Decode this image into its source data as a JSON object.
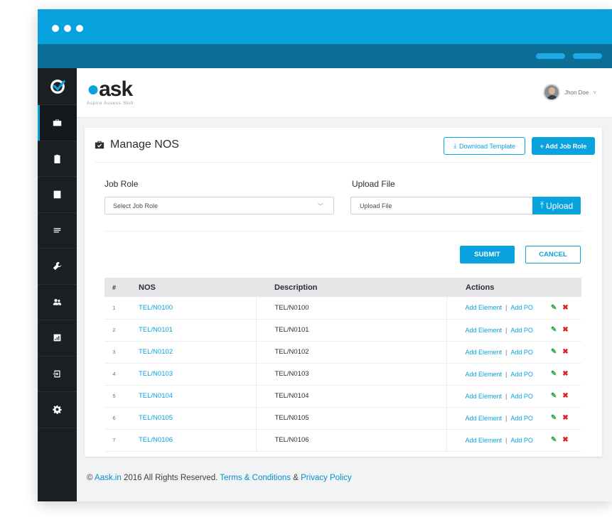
{
  "brand": {
    "name": "ask",
    "tagline": "Aspire Assess Skill"
  },
  "user": {
    "name": "Jhon Doe",
    "chevron": "˅"
  },
  "sidebar": {
    "items": [
      {
        "icon": "briefcase-icon"
      },
      {
        "icon": "clipboard-icon"
      },
      {
        "icon": "id-badge-icon"
      },
      {
        "icon": "list-icon"
      },
      {
        "icon": "wrench-icon"
      },
      {
        "icon": "users-icon"
      },
      {
        "icon": "bar-chart-icon"
      },
      {
        "icon": "sign-in-icon"
      },
      {
        "icon": "gear-icon"
      }
    ]
  },
  "page": {
    "title": "Manage NOS",
    "download_label": "Download Template",
    "add_label": "+ Add Job Role"
  },
  "form": {
    "job_role_label": "Job Role",
    "job_role_placeholder": "Select Job Role",
    "upload_label": "Upload File",
    "upload_placeholder": "Upload File",
    "upload_button": "Upload",
    "submit": "SUBMIT",
    "cancel": "CANCEL"
  },
  "table": {
    "headers": {
      "num": "#",
      "nos": "NOS",
      "description": "Description",
      "actions": "Actions"
    },
    "action_add_element": "Add Element",
    "action_add_po": "Add PO",
    "action_separator": "|",
    "edit_symbol": "✎",
    "delete_symbol": "✖",
    "rows": [
      {
        "num": "1",
        "nos": "TEL/N0100",
        "description": "TEL/N0100"
      },
      {
        "num": "2",
        "nos": "TEL/N0101",
        "description": "TEL/N0101"
      },
      {
        "num": "3",
        "nos": "TEL/N0102",
        "description": "TEL/N0102"
      },
      {
        "num": "4",
        "nos": "TEL/N0103",
        "description": "TEL/N0103"
      },
      {
        "num": "5",
        "nos": "TEL/N0104",
        "description": "TEL/N0104"
      },
      {
        "num": "6",
        "nos": "TEL/N0105",
        "description": "TEL/N0105"
      },
      {
        "num": "7",
        "nos": "TEL/N0106",
        "description": "TEL/N0106"
      }
    ]
  },
  "footer": {
    "prefix": "© ",
    "site": "Aask.in",
    "mid": " 2016 All Rights Reserved. ",
    "terms": "Terms & Conditions",
    "amp": " & ",
    "privacy": "Privacy Policy"
  },
  "colors": {
    "accent": "#08a2df",
    "header_dark": "#0a6e96",
    "sidebar": "#1c1f22",
    "edit": "#2aa63c",
    "delete": "#e02020"
  }
}
